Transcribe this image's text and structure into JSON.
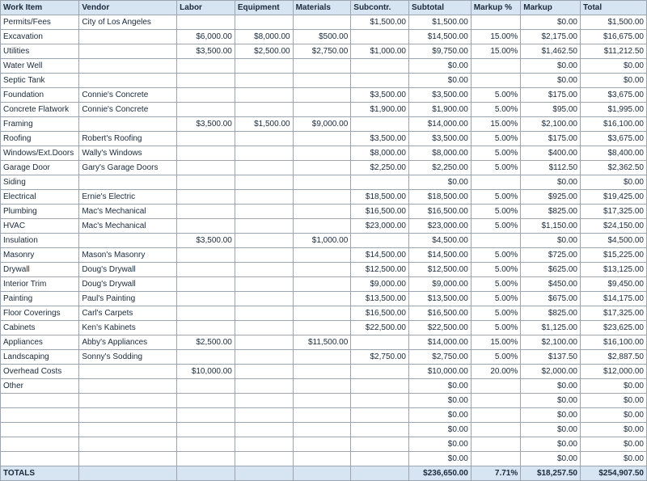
{
  "headers": [
    "Work Item",
    "Vendor",
    "Labor",
    "Equipment",
    "Materials",
    "Subcontr.",
    "Subtotal",
    "Markup %",
    "Markup",
    "Total"
  ],
  "rows": [
    {
      "work": "Permits/Fees",
      "vendor": "City of Los Angeles",
      "labor": "",
      "equip": "",
      "mat": "",
      "sub": "$1,500.00",
      "subtotal": "$1,500.00",
      "mpct": "",
      "markup": "$0.00",
      "total": "$1,500.00"
    },
    {
      "work": "Excavation",
      "vendor": "",
      "labor": "$6,000.00",
      "equip": "$8,000.00",
      "mat": "$500.00",
      "sub": "",
      "subtotal": "$14,500.00",
      "mpct": "15.00%",
      "markup": "$2,175.00",
      "total": "$16,675.00"
    },
    {
      "work": "Utilities",
      "vendor": "",
      "labor": "$3,500.00",
      "equip": "$2,500.00",
      "mat": "$2,750.00",
      "sub": "$1,000.00",
      "subtotal": "$9,750.00",
      "mpct": "15.00%",
      "markup": "$1,462.50",
      "total": "$11,212.50"
    },
    {
      "work": "Water Well",
      "vendor": "",
      "labor": "",
      "equip": "",
      "mat": "",
      "sub": "",
      "subtotal": "$0.00",
      "mpct": "",
      "markup": "$0.00",
      "total": "$0.00"
    },
    {
      "work": "Septic Tank",
      "vendor": "",
      "labor": "",
      "equip": "",
      "mat": "",
      "sub": "",
      "subtotal": "$0.00",
      "mpct": "",
      "markup": "$0.00",
      "total": "$0.00"
    },
    {
      "work": "Foundation",
      "vendor": "Connie's Concrete",
      "labor": "",
      "equip": "",
      "mat": "",
      "sub": "$3,500.00",
      "subtotal": "$3,500.00",
      "mpct": "5.00%",
      "markup": "$175.00",
      "total": "$3,675.00"
    },
    {
      "work": "Concrete Flatwork",
      "vendor": "Connie's Concrete",
      "labor": "",
      "equip": "",
      "mat": "",
      "sub": "$1,900.00",
      "subtotal": "$1,900.00",
      "mpct": "5.00%",
      "markup": "$95.00",
      "total": "$1,995.00"
    },
    {
      "work": "Framing",
      "vendor": "",
      "labor": "$3,500.00",
      "equip": "$1,500.00",
      "mat": "$9,000.00",
      "sub": "",
      "subtotal": "$14,000.00",
      "mpct": "15.00%",
      "markup": "$2,100.00",
      "total": "$16,100.00"
    },
    {
      "work": "Roofing",
      "vendor": "Robert's Roofing",
      "labor": "",
      "equip": "",
      "mat": "",
      "sub": "$3,500.00",
      "subtotal": "$3,500.00",
      "mpct": "5.00%",
      "markup": "$175.00",
      "total": "$3,675.00"
    },
    {
      "work": "Windows/Ext.Doors",
      "vendor": "Wally's Windows",
      "labor": "",
      "equip": "",
      "mat": "",
      "sub": "$8,000.00",
      "subtotal": "$8,000.00",
      "mpct": "5.00%",
      "markup": "$400.00",
      "total": "$8,400.00"
    },
    {
      "work": "Garage Door",
      "vendor": "Gary's Garage Doors",
      "labor": "",
      "equip": "",
      "mat": "",
      "sub": "$2,250.00",
      "subtotal": "$2,250.00",
      "mpct": "5.00%",
      "markup": "$112.50",
      "total": "$2,362.50"
    },
    {
      "work": "Siding",
      "vendor": "",
      "labor": "",
      "equip": "",
      "mat": "",
      "sub": "",
      "subtotal": "$0.00",
      "mpct": "",
      "markup": "$0.00",
      "total": "$0.00"
    },
    {
      "work": "Electrical",
      "vendor": "Ernie's Electric",
      "labor": "",
      "equip": "",
      "mat": "",
      "sub": "$18,500.00",
      "subtotal": "$18,500.00",
      "mpct": "5.00%",
      "markup": "$925.00",
      "total": "$19,425.00"
    },
    {
      "work": "Plumbing",
      "vendor": "Mac's Mechanical",
      "labor": "",
      "equip": "",
      "mat": "",
      "sub": "$16,500.00",
      "subtotal": "$16,500.00",
      "mpct": "5.00%",
      "markup": "$825.00",
      "total": "$17,325.00"
    },
    {
      "work": "HVAC",
      "vendor": "Mac's Mechanical",
      "labor": "",
      "equip": "",
      "mat": "",
      "sub": "$23,000.00",
      "subtotal": "$23,000.00",
      "mpct": "5.00%",
      "markup": "$1,150.00",
      "total": "$24,150.00"
    },
    {
      "work": "Insulation",
      "vendor": "",
      "labor": "$3,500.00",
      "equip": "",
      "mat": "$1,000.00",
      "sub": "",
      "subtotal": "$4,500.00",
      "mpct": "",
      "markup": "$0.00",
      "total": "$4,500.00"
    },
    {
      "work": "Masonry",
      "vendor": "Mason's Masonry",
      "labor": "",
      "equip": "",
      "mat": "",
      "sub": "$14,500.00",
      "subtotal": "$14,500.00",
      "mpct": "5.00%",
      "markup": "$725.00",
      "total": "$15,225.00"
    },
    {
      "work": "Drywall",
      "vendor": "Doug's Drywall",
      "labor": "",
      "equip": "",
      "mat": "",
      "sub": "$12,500.00",
      "subtotal": "$12,500.00",
      "mpct": "5.00%",
      "markup": "$625.00",
      "total": "$13,125.00"
    },
    {
      "work": "Interior Trim",
      "vendor": "Doug's Drywall",
      "labor": "",
      "equip": "",
      "mat": "",
      "sub": "$9,000.00",
      "subtotal": "$9,000.00",
      "mpct": "5.00%",
      "markup": "$450.00",
      "total": "$9,450.00"
    },
    {
      "work": "Painting",
      "vendor": "Paul's Painting",
      "labor": "",
      "equip": "",
      "mat": "",
      "sub": "$13,500.00",
      "subtotal": "$13,500.00",
      "mpct": "5.00%",
      "markup": "$675.00",
      "total": "$14,175.00"
    },
    {
      "work": "Floor Coverings",
      "vendor": "Carl's Carpets",
      "labor": "",
      "equip": "",
      "mat": "",
      "sub": "$16,500.00",
      "subtotal": "$16,500.00",
      "mpct": "5.00%",
      "markup": "$825.00",
      "total": "$17,325.00"
    },
    {
      "work": "Cabinets",
      "vendor": "Ken's Kabinets",
      "labor": "",
      "equip": "",
      "mat": "",
      "sub": "$22,500.00",
      "subtotal": "$22,500.00",
      "mpct": "5.00%",
      "markup": "$1,125.00",
      "total": "$23,625.00"
    },
    {
      "work": "Appliances",
      "vendor": "Abby's Appliances",
      "labor": "$2,500.00",
      "equip": "",
      "mat": "$11,500.00",
      "sub": "",
      "subtotal": "$14,000.00",
      "mpct": "15.00%",
      "markup": "$2,100.00",
      "total": "$16,100.00"
    },
    {
      "work": "Landscaping",
      "vendor": "Sonny's Sodding",
      "labor": "",
      "equip": "",
      "mat": "",
      "sub": "$2,750.00",
      "subtotal": "$2,750.00",
      "mpct": "5.00%",
      "markup": "$137.50",
      "total": "$2,887.50"
    },
    {
      "work": "Overhead Costs",
      "vendor": "",
      "labor": "$10,000.00",
      "equip": "",
      "mat": "",
      "sub": "",
      "subtotal": "$10,000.00",
      "mpct": "20.00%",
      "markup": "$2,000.00",
      "total": "$12,000.00"
    },
    {
      "work": "Other",
      "vendor": "",
      "labor": "",
      "equip": "",
      "mat": "",
      "sub": "",
      "subtotal": "$0.00",
      "mpct": "",
      "markup": "$0.00",
      "total": "$0.00"
    },
    {
      "work": "",
      "vendor": "",
      "labor": "",
      "equip": "",
      "mat": "",
      "sub": "",
      "subtotal": "$0.00",
      "mpct": "",
      "markup": "$0.00",
      "total": "$0.00"
    },
    {
      "work": "",
      "vendor": "",
      "labor": "",
      "equip": "",
      "mat": "",
      "sub": "",
      "subtotal": "$0.00",
      "mpct": "",
      "markup": "$0.00",
      "total": "$0.00"
    },
    {
      "work": "",
      "vendor": "",
      "labor": "",
      "equip": "",
      "mat": "",
      "sub": "",
      "subtotal": "$0.00",
      "mpct": "",
      "markup": "$0.00",
      "total": "$0.00"
    },
    {
      "work": "",
      "vendor": "",
      "labor": "",
      "equip": "",
      "mat": "",
      "sub": "",
      "subtotal": "$0.00",
      "mpct": "",
      "markup": "$0.00",
      "total": "$0.00"
    },
    {
      "work": "",
      "vendor": "",
      "labor": "",
      "equip": "",
      "mat": "",
      "sub": "",
      "subtotal": "$0.00",
      "mpct": "",
      "markup": "$0.00",
      "total": "$0.00"
    }
  ],
  "totals": {
    "label": "TOTALS",
    "subtotal": "$236,650.00",
    "mpct": "7.71%",
    "markup": "$18,257.50",
    "total": "$254,907.50"
  }
}
